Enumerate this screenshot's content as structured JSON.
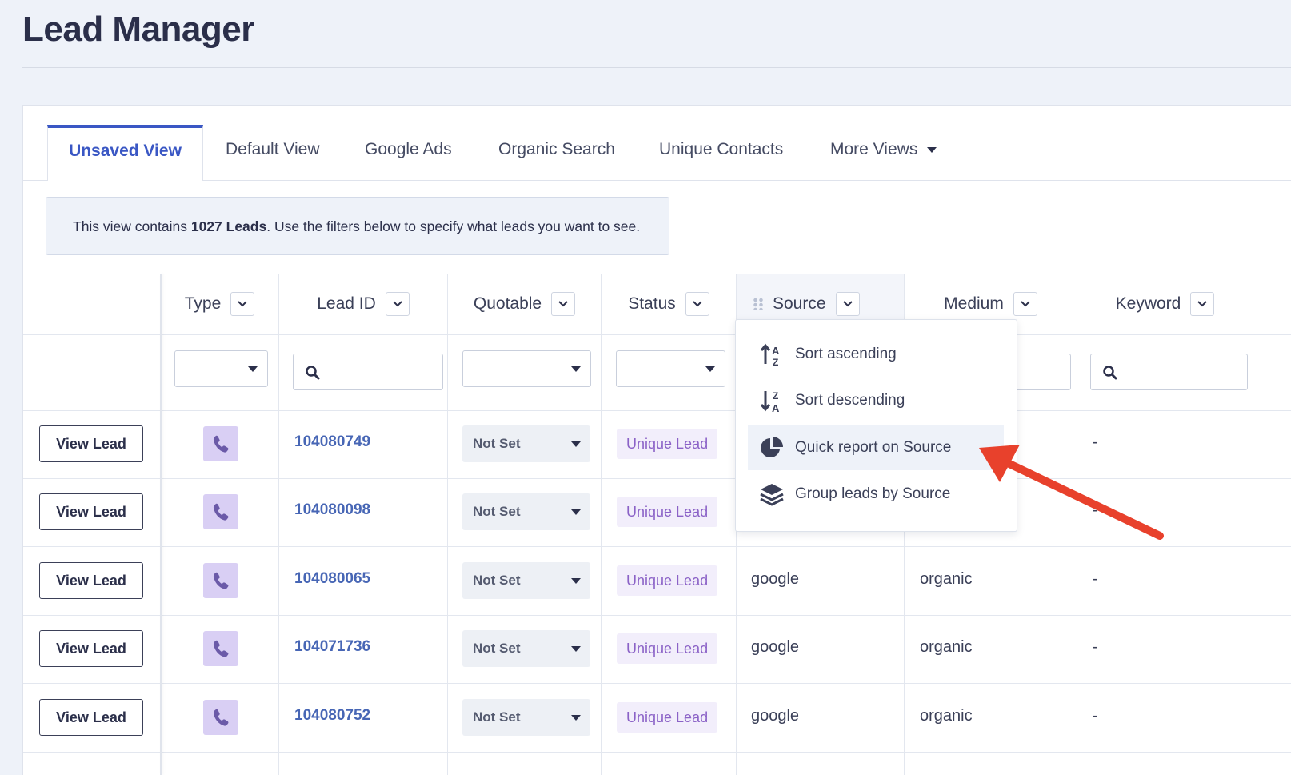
{
  "page": {
    "title": "Lead Manager"
  },
  "tabs": [
    {
      "label": "Unsaved View",
      "active": true
    },
    {
      "label": "Default View"
    },
    {
      "label": "Google Ads"
    },
    {
      "label": "Organic Search"
    },
    {
      "label": "Unique Contacts"
    },
    {
      "label": "More Views"
    }
  ],
  "info": {
    "prefix": "This view contains ",
    "count": "1027 Leads",
    "suffix": ". Use the filters below to specify what leads you want to see."
  },
  "columns": [
    "Type",
    "Lead ID",
    "Quotable",
    "Status",
    "Source",
    "Medium",
    "Keyword"
  ],
  "rows": [
    {
      "action": "View Lead",
      "type_icon": "phone-icon",
      "lead_id": "104080749",
      "quotable": "Not Set",
      "status": "Unique Lead",
      "source": "",
      "medium": "",
      "keyword": "-"
    },
    {
      "action": "View Lead",
      "type_icon": "phone-icon",
      "lead_id": "104080098",
      "quotable": "Not Set",
      "status": "Unique Lead",
      "source": "",
      "medium": "",
      "keyword": "-"
    },
    {
      "action": "View Lead",
      "type_icon": "phone-icon",
      "lead_id": "104080065",
      "quotable": "Not Set",
      "status": "Unique Lead",
      "source": "google",
      "medium": "organic",
      "keyword": "-"
    },
    {
      "action": "View Lead",
      "type_icon": "phone-icon",
      "lead_id": "104071736",
      "quotable": "Not Set",
      "status": "Unique Lead",
      "source": "google",
      "medium": "organic",
      "keyword": "-"
    },
    {
      "action": "View Lead",
      "type_icon": "phone-icon",
      "lead_id": "104080752",
      "quotable": "Not Set",
      "status": "Unique Lead",
      "source": "google",
      "medium": "organic",
      "keyword": "-"
    }
  ],
  "column_menu": {
    "items": [
      {
        "label": "Sort ascending",
        "icon": "sort-ascending-icon"
      },
      {
        "label": "Sort descending",
        "icon": "sort-descending-icon"
      },
      {
        "label": "Quick report on Source",
        "icon": "pie-chart-icon",
        "highlighted": true
      },
      {
        "label": "Group leads by Source",
        "icon": "layers-icon"
      }
    ]
  },
  "colors": {
    "accent": "#3a57c4",
    "link": "#4766b5",
    "status_text": "#8b62c7",
    "status_bg": "#f2eefb",
    "arrow": "#e8412c"
  }
}
